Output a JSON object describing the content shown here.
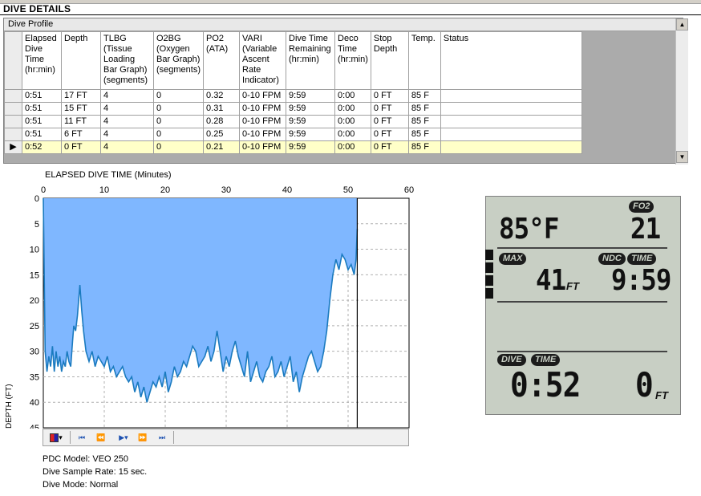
{
  "page": {
    "title": "DIVE DETAILS"
  },
  "grid": {
    "caption": "Dive Profile",
    "columns": [
      "Elapsed Dive Time (hr:min)",
      "Depth",
      "TLBG (Tissue Loading Bar Graph) (segments)",
      "O2BG (Oxygen Bar Graph) (segments)",
      "PO2 (ATA)",
      "VARI (Variable Ascent Rate Indicator)",
      "Dive Time Remaining (hr:min)",
      "Deco Time (hr:min)",
      "Stop Depth",
      "Temp.",
      "Status"
    ],
    "rows": [
      [
        "0:51",
        "17 FT",
        "4",
        "0",
        "0.32",
        "0-10 FPM",
        "9:59",
        "0:00",
        "0 FT",
        "85 F",
        ""
      ],
      [
        "0:51",
        "15 FT",
        "4",
        "0",
        "0.31",
        "0-10 FPM",
        "9:59",
        "0:00",
        "0 FT",
        "85 F",
        ""
      ],
      [
        "0:51",
        "11 FT",
        "4",
        "0",
        "0.28",
        "0-10 FPM",
        "9:59",
        "0:00",
        "0 FT",
        "85 F",
        ""
      ],
      [
        "0:51",
        "6 FT",
        "4",
        "0",
        "0.25",
        "0-10 FPM",
        "9:59",
        "0:00",
        "0 FT",
        "85 F",
        ""
      ],
      [
        "0:52",
        "0 FT",
        "4",
        "0",
        "0.21",
        "0-10 FPM",
        "9:59",
        "0:00",
        "0 FT",
        "85 F",
        ""
      ]
    ],
    "current_row_index": 4,
    "current_row_marker": "▶",
    "current_row_color": "#ffffc8"
  },
  "chart_data": {
    "type": "area",
    "title": "ELAPSED DIVE TIME (Minutes)",
    "xlabel": "ELAPSED DIVE TIME (Minutes)",
    "ylabel": "DEPTH (FT)",
    "x_ticks": [
      0,
      10,
      20,
      30,
      40,
      50,
      60
    ],
    "y_ticks": [
      0,
      5,
      10,
      15,
      20,
      25,
      30,
      35,
      40,
      45
    ],
    "xlim": [
      0,
      60
    ],
    "ylim": [
      0,
      45
    ],
    "y_inverted": true,
    "grid": true,
    "fill_color": "#7fb7ff",
    "line_color": "#1a7abf",
    "cursor_x": 51.5,
    "x": [
      0,
      0.3,
      0.6,
      0.9,
      1.2,
      1.5,
      1.8,
      2.1,
      2.4,
      2.7,
      3,
      3.3,
      3.6,
      3.9,
      4.2,
      4.5,
      4.8,
      5,
      5.3,
      5.6,
      6,
      6.3,
      6.6,
      7,
      7.5,
      8,
      8.5,
      9,
      9.5,
      10,
      10.5,
      11,
      11.5,
      12,
      12.5,
      13,
      13.5,
      14,
      14.5,
      15,
      15.5,
      16,
      16.5,
      17,
      17.5,
      18,
      18.5,
      19,
      19.5,
      20,
      20.5,
      21,
      21.5,
      22,
      22.5,
      23,
      23.5,
      24,
      24.5,
      25,
      25.5,
      26,
      26.5,
      27,
      27.5,
      28,
      28.5,
      29,
      29.5,
      30,
      30.5,
      31,
      31.5,
      32,
      32.5,
      33,
      33.5,
      34,
      34.5,
      35,
      35.5,
      36,
      36.5,
      37,
      37.5,
      38,
      38.5,
      39,
      39.5,
      40,
      40.5,
      41,
      41.5,
      42,
      42.5,
      43,
      43.5,
      44,
      44.5,
      45,
      45.5,
      46,
      46.5,
      47,
      47.5,
      48,
      48.5,
      49,
      49.5,
      50,
      50.5,
      51,
      51.3,
      51.5
    ],
    "y": [
      0,
      30,
      34,
      31,
      33,
      29,
      34,
      30,
      33,
      31,
      34,
      32,
      33,
      30,
      32,
      33,
      28,
      25,
      26,
      23,
      17,
      22,
      26,
      30,
      32,
      30,
      33,
      31,
      32,
      33,
      31,
      34,
      33,
      35,
      34,
      33,
      35,
      36,
      35,
      38,
      36,
      39,
      37,
      40,
      38,
      36,
      37,
      35,
      37,
      34,
      38,
      36,
      33,
      35,
      34,
      32,
      33,
      31,
      29,
      30,
      33,
      32,
      31,
      29,
      32,
      30,
      26,
      30,
      34,
      31,
      33,
      30,
      28,
      31,
      33,
      35,
      30,
      36,
      34,
      32,
      35,
      36,
      34,
      33,
      31,
      35,
      34,
      32,
      35,
      33,
      31,
      36,
      34,
      38,
      35,
      33,
      31,
      30,
      32,
      34,
      33,
      30,
      26,
      20,
      15,
      12,
      14,
      11,
      12,
      14,
      13,
      15,
      12,
      6,
      0
    ]
  },
  "toolbar": {
    "icons": [
      "palette-icon",
      "first-icon",
      "rewind-icon",
      "play-icon",
      "fast-forward-icon",
      "last-icon"
    ],
    "glyphs": {
      "palette": "▾",
      "first": "⏮",
      "rewind": "⏪",
      "play": "▶▾",
      "ff": "⏩",
      "last": "⏭"
    }
  },
  "info": {
    "pdc_model": "PDC Model: VEO 250",
    "sample_rate": "Dive Sample Rate: 15 sec.",
    "dive_mode": "Dive Mode: Normal"
  },
  "lcd": {
    "fo2_label": "FO2",
    "temp_value": "85°F",
    "fo2_value": "21",
    "max_label": "MAX",
    "max_depth": "41",
    "max_unit": "FT",
    "ndc_label": "NDC",
    "time_label": "TIME",
    "ndc_time": "9:59",
    "dive_label": "DIVE",
    "dive_time_label": "TIME",
    "dive_time": "0:52",
    "current_depth": "0",
    "depth_unit": "FT"
  }
}
